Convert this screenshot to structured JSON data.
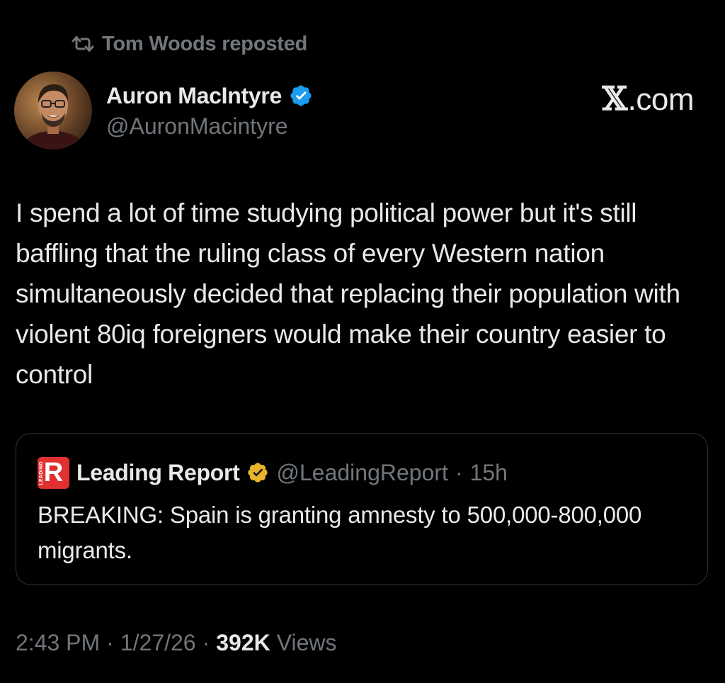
{
  "repost": {
    "icon": "repost-icon",
    "text": "Tom Woods reposted"
  },
  "author": {
    "name": "Auron MacIntyre",
    "handle": "@AuronMacintyre",
    "verified": true,
    "verified_color": "#1d9bf0",
    "avatar_icon": "avatar-photo"
  },
  "brand": {
    "x_glyph": "𝕏",
    "suffix": ".com"
  },
  "tweet": {
    "text": "I spend a lot of time studying political power but it's still baffling that the ruling class of every Western nation simultaneously decided that replacing their population with violent 80iq foreigners would make their country easier to control"
  },
  "quote": {
    "logo_letter": "R",
    "logo_tag": "LEADING",
    "logo_color": "#e0302f",
    "name": "Leading Report",
    "verified_color": "#e8b52a",
    "handle": "@LeadingReport",
    "separator": "·",
    "time": "15h",
    "text": "BREAKING: Spain is granting amnesty to 500,000-800,000 migrants."
  },
  "meta": {
    "time": "2:43 PM",
    "separator": "·",
    "date": "1/27/26",
    "views_count": "392K",
    "views_label": "Views"
  }
}
